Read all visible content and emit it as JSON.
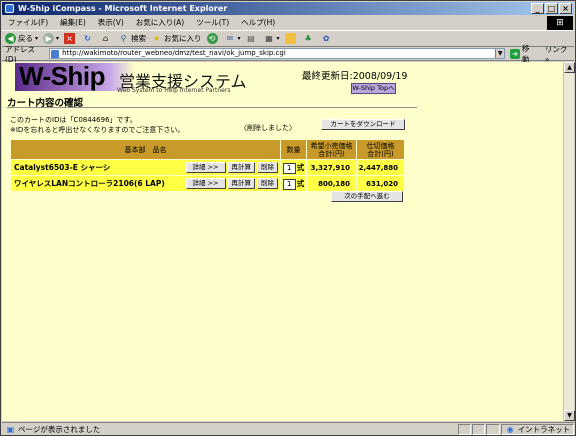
{
  "window": {
    "title": "W-Ship iCompass - Microsoft Internet Explorer",
    "min": "_",
    "max": "□",
    "close": "×"
  },
  "menu": [
    "ファイル(F)",
    "編集(E)",
    "表示(V)",
    "お気に入り(A)",
    "ツール(T)",
    "ヘルプ(H)"
  ],
  "toolbar": {
    "back": "戻る",
    "search": "検索",
    "favorites": "お気に入り"
  },
  "address": {
    "label": "アドレス(D)",
    "url": "http://wakimoto/router_webneo/dmz/test_navi/ok_jump_skip.cgi",
    "go": "移動",
    "links": "リンク »"
  },
  "header": {
    "brand": "W-Ship",
    "brand_jp": "営業支援システム",
    "subtitle": "Web System to Help Internet Partners",
    "last_updated": "最終更新日:2008/09/19",
    "top_link": "W-Ship Topへ"
  },
  "page": {
    "title": "カート内容の確認",
    "cart_id_text": "このカートのIDは「C0844696」です。",
    "notice": "※IDを忘れると呼出せなくなりますのでご注意下さい。",
    "deleted_msg": "〈削除しました〉",
    "download_button": "カートをダウンロード",
    "next_button": "次の手配へ進む"
  },
  "table": {
    "headers": {
      "name": "基本部　品名",
      "qty": "数量",
      "list_price": "希望小売価格\n合計(円)",
      "cost_price": "仕切価格\n合計(円)"
    },
    "detail_label": "詳細 >>",
    "recalc_label": "再計算",
    "delete_label": "削除",
    "unit": "式",
    "rows": [
      {
        "name": "Catalyst6503-E シャーシ",
        "qty": "1",
        "list_price": "3,327,910",
        "cost_price": "2,447,880"
      },
      {
        "name": "ワイヤレスLANコントローラ2106(6 LAP)",
        "qty": "1",
        "list_price": "800,180",
        "cost_price": "631,020"
      }
    ]
  },
  "status": {
    "text": "ページが表示されました",
    "zone": "イントラネット"
  },
  "colors": {
    "page_bg": "#ffffcc",
    "header_cell": "#c89a2a",
    "row_cell": "#ffff44",
    "titlebar": "#0a246a"
  }
}
